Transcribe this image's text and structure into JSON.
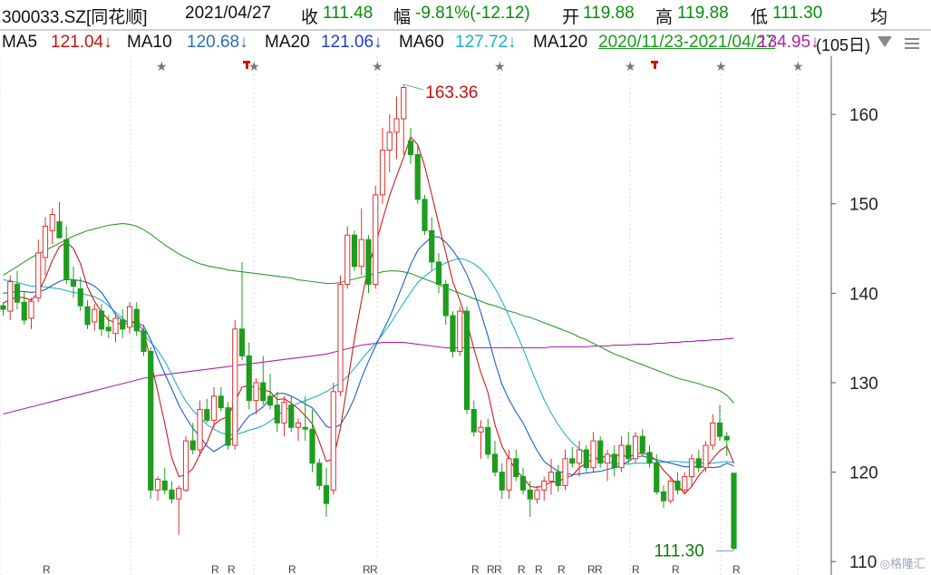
{
  "header": {
    "code": "300033.SZ[同花顺]",
    "date": "2021/04/27",
    "close_label": "收",
    "close_value": "111.48",
    "change_label": "幅",
    "change_value": "-9.81%(-12.12)",
    "open_label": "开",
    "open_value": "119.88",
    "high_label": "高",
    "high_value": "119.88",
    "low_label": "低",
    "low_value": "111.30",
    "avg_label": "均"
  },
  "ma_bar": {
    "ma5_label": "MA5",
    "ma5_value": "121.04↓",
    "ma10_label": "MA10",
    "ma10_value": "120.68↓",
    "ma20_label": "MA20",
    "ma20_value": "121.06↓",
    "ma60_label": "MA60",
    "ma60_value": "127.72↓",
    "ma120_label": "MA120",
    "overlap_a": "2020/11/23-2021/04/27",
    "overlap_b": "134.95↓",
    "days": "(105日)"
  },
  "chart_data": {
    "type": "candlestick",
    "ylim": [
      108.5,
      166.5
    ],
    "yticks": [
      110,
      120,
      130,
      140,
      150,
      160
    ],
    "ytick_labels": [
      "110",
      "120",
      "130",
      "140",
      "150",
      "160"
    ],
    "colors": {
      "up": "#e03030",
      "down": "#1e9c1e",
      "ma5": "#c81e1e",
      "ma10": "#1e5fcc",
      "ma20": "#20b4c8",
      "ma60": "#2aa02a",
      "ma120": "#b01eb0"
    },
    "annotations": [
      {
        "text": "163.36",
        "value": 163.36,
        "color": "#c81010"
      },
      {
        "text": "111.30",
        "value": 111.3,
        "color": "#0a7c0a"
      }
    ],
    "ohlc": [
      [
        138.6,
        139.0,
        137.5,
        138.2
      ],
      [
        138.0,
        142.0,
        137.0,
        141.3
      ],
      [
        141.0,
        142.5,
        138.2,
        139.0
      ],
      [
        139.0,
        140.2,
        136.5,
        137.0
      ],
      [
        137.2,
        139.5,
        136.0,
        139.1
      ],
      [
        139.5,
        146.0,
        139.0,
        144.5
      ],
      [
        144.0,
        148.5,
        142.0,
        147.5
      ],
      [
        147.0,
        149.5,
        145.5,
        148.8
      ],
      [
        148.0,
        150.2,
        146.5,
        146.2
      ],
      [
        146.0,
        147.5,
        141.0,
        141.5
      ],
      [
        141.5,
        143.0,
        139.5,
        140.8
      ],
      [
        140.5,
        141.8,
        138.0,
        138.6
      ],
      [
        138.5,
        139.2,
        136.0,
        136.5
      ],
      [
        136.8,
        138.8,
        135.8,
        138.2
      ],
      [
        138.0,
        138.8,
        135.2,
        136.0
      ],
      [
        136.2,
        137.5,
        135.0,
        135.8
      ],
      [
        135.5,
        137.8,
        134.5,
        137.2
      ],
      [
        137.0,
        138.2,
        135.0,
        136.0
      ],
      [
        136.2,
        139.0,
        135.5,
        138.5
      ],
      [
        138.2,
        139.0,
        135.2,
        135.8
      ],
      [
        135.8,
        136.5,
        133.0,
        133.5
      ],
      [
        133.5,
        134.0,
        117.0,
        118.0
      ],
      [
        118.0,
        119.5,
        116.8,
        119.2
      ],
      [
        119.0,
        120.5,
        117.5,
        118.0
      ],
      [
        118.0,
        119.0,
        116.5,
        117.0
      ],
      [
        117.0,
        118.5,
        113.0,
        118.2
      ],
      [
        118.0,
        124.0,
        117.8,
        123.5
      ],
      [
        123.5,
        125.5,
        122.0,
        122.5
      ],
      [
        122.5,
        128.0,
        121.8,
        127.0
      ],
      [
        127.0,
        128.2,
        125.5,
        125.8
      ],
      [
        125.8,
        129.5,
        125.0,
        128.5
      ],
      [
        128.5,
        129.5,
        126.8,
        127.2
      ],
      [
        127.2,
        127.8,
        122.5,
        123.0
      ],
      [
        123.0,
        137.0,
        122.5,
        136.0
      ],
      [
        136.0,
        143.5,
        132.5,
        133.0
      ],
      [
        133.0,
        134.5,
        127.0,
        128.0
      ],
      [
        128.0,
        130.5,
        126.5,
        130.0
      ],
      [
        130.0,
        133.0,
        127.5,
        128.0
      ],
      [
        128.5,
        131.0,
        127.0,
        127.5
      ],
      [
        127.5,
        129.0,
        124.5,
        125.5
      ],
      [
        125.5,
        128.5,
        124.0,
        127.8
      ],
      [
        127.5,
        128.5,
        124.5,
        125.0
      ],
      [
        125.0,
        126.0,
        123.5,
        125.5
      ],
      [
        125.0,
        128.5,
        123.5,
        124.8
      ],
      [
        124.8,
        127.0,
        120.0,
        121.0
      ],
      [
        121.0,
        121.5,
        118.0,
        118.5
      ],
      [
        118.5,
        120.5,
        115.0,
        116.5
      ],
      [
        118.0,
        130.0,
        117.5,
        129.0
      ],
      [
        129.0,
        142.0,
        128.5,
        141.0
      ],
      [
        141.0,
        147.5,
        140.5,
        146.5
      ],
      [
        146.5,
        147.0,
        142.5,
        143.0
      ],
      [
        143.0,
        149.5,
        142.0,
        146.0
      ],
      [
        146.0,
        146.5,
        140.0,
        141.0
      ],
      [
        141.0,
        152.0,
        140.5,
        151.0
      ],
      [
        151.0,
        158.5,
        150.0,
        156.0
      ],
      [
        156.0,
        160.0,
        153.5,
        158.0
      ],
      [
        158.0,
        162.0,
        155.0,
        159.5
      ],
      [
        159.5,
        163.36,
        155.5,
        163.0
      ],
      [
        157.0,
        158.5,
        154.5,
        155.5
      ],
      [
        155.5,
        156.5,
        150.0,
        150.5
      ],
      [
        150.5,
        151.0,
        146.5,
        147.0
      ],
      [
        147.0,
        148.5,
        142.5,
        143.5
      ],
      [
        143.5,
        144.5,
        140.0,
        141.0
      ],
      [
        141.0,
        141.5,
        136.5,
        137.5
      ],
      [
        137.5,
        138.0,
        132.8,
        133.5
      ],
      [
        133.5,
        138.5,
        133.0,
        138.0
      ],
      [
        138.0,
        138.5,
        126.5,
        127.0
      ],
      [
        127.0,
        128.0,
        124.0,
        124.5
      ],
      [
        124.5,
        125.8,
        121.5,
        125.0
      ],
      [
        125.0,
        126.0,
        121.5,
        122.0
      ],
      [
        122.0,
        123.5,
        119.5,
        120.0
      ],
      [
        120.0,
        121.0,
        117.0,
        118.0
      ],
      [
        118.0,
        122.5,
        117.0,
        121.5
      ],
      [
        121.5,
        122.5,
        119.0,
        119.5
      ],
      [
        119.5,
        120.5,
        117.5,
        118.0
      ],
      [
        118.0,
        119.0,
        115.0,
        117.0
      ],
      [
        117.0,
        118.5,
        116.5,
        118.0
      ],
      [
        118.0,
        119.5,
        116.8,
        119.0
      ],
      [
        119.0,
        121.5,
        117.5,
        120.0
      ],
      [
        120.0,
        120.8,
        117.8,
        118.5
      ],
      [
        118.5,
        122.5,
        118.0,
        121.5
      ],
      [
        121.5,
        122.8,
        120.5,
        121.0
      ],
      [
        121.0,
        123.5,
        119.5,
        122.5
      ],
      [
        122.5,
        123.0,
        120.0,
        120.5
      ],
      [
        120.5,
        124.5,
        120.0,
        123.5
      ],
      [
        123.5,
        124.0,
        120.5,
        121.0
      ],
      [
        121.0,
        122.5,
        119.0,
        122.0
      ],
      [
        122.0,
        123.0,
        119.5,
        120.5
      ],
      [
        120.5,
        124.0,
        120.0,
        123.0
      ],
      [
        123.0,
        124.5,
        121.0,
        121.5
      ],
      [
        121.5,
        124.5,
        121.0,
        124.0
      ],
      [
        124.0,
        124.8,
        121.8,
        122.2
      ],
      [
        122.2,
        123.0,
        120.5,
        121.0
      ],
      [
        121.0,
        122.0,
        117.5,
        117.8
      ],
      [
        117.8,
        118.5,
        116.0,
        116.8
      ],
      [
        116.8,
        119.5,
        116.5,
        119.0
      ],
      [
        119.0,
        120.0,
        117.5,
        118.0
      ],
      [
        118.0,
        120.0,
        117.5,
        119.5
      ],
      [
        119.5,
        122.0,
        118.5,
        121.5
      ],
      [
        121.5,
        122.5,
        120.0,
        120.5
      ],
      [
        120.5,
        123.5,
        120.0,
        123.0
      ],
      [
        123.0,
        126.5,
        122.5,
        125.5
      ],
      [
        125.5,
        127.5,
        123.5,
        124.0
      ],
      [
        124.0,
        124.5,
        121.8,
        123.6
      ],
      [
        119.88,
        119.88,
        111.3,
        111.48
      ]
    ],
    "ma5": [
      138.9,
      139.3,
      139.6,
      139.5,
      139.2,
      140.1,
      141.7,
      143.7,
      145.2,
      145.7,
      145.0,
      143.3,
      140.7,
      139.1,
      137.9,
      137.0,
      136.7,
      136.5,
      136.7,
      136.7,
      135.8,
      132.4,
      129.0,
      125.4,
      121.6,
      119.5,
      119.7,
      120.4,
      122.0,
      123.3,
      125.3,
      125.9,
      126.2,
      127.9,
      129.5,
      129.7,
      129.4,
      129.2,
      129.0,
      128.1,
      128.2,
      127.7,
      127.1,
      126.3,
      125.4,
      123.4,
      121.2,
      121.5,
      124.9,
      129.9,
      134.9,
      139.2,
      143.0,
      145.5,
      148.2,
      150.9,
      153.1,
      155.2,
      157.5,
      156.6,
      154.2,
      151.0,
      147.7,
      144.5,
      141.3,
      139.2,
      136.8,
      133.8,
      131.1,
      128.9,
      125.3,
      122.9,
      121.5,
      120.2,
      119.4,
      118.4,
      118.3,
      118.5,
      118.9,
      118.9,
      119.4,
      119.6,
      120.5,
      121.0,
      121.5,
      121.6,
      121.8,
      121.8,
      122.0,
      121.6,
      122.1,
      122.1,
      121.9,
      121.3,
      120.2,
      119.4,
      118.5,
      117.6,
      118.4,
      119.6,
      120.5,
      121.5,
      122.4,
      122.9,
      121.0
    ],
    "ma10": [
      140.0,
      140.1,
      140.2,
      140.2,
      140.1,
      140.2,
      140.4,
      140.9,
      141.3,
      141.6,
      141.5,
      141.4,
      141.2,
      140.8,
      140.1,
      138.9,
      137.6,
      136.9,
      136.8,
      136.8,
      136.3,
      134.8,
      132.8,
      131.0,
      129.3,
      127.5,
      126.1,
      124.9,
      124.0,
      122.9,
      122.3,
      122.8,
      123.3,
      124.1,
      125.3,
      126.3,
      126.7,
      127.3,
      128.2,
      128.8,
      128.8,
      128.5,
      128.1,
      127.6,
      127.2,
      126.2,
      125.1,
      124.9,
      125.3,
      126.6,
      128.3,
      130.5,
      132.4,
      134.1,
      135.7,
      137.3,
      139.2,
      141.2,
      143.2,
      144.8,
      145.6,
      146.3,
      146.3,
      145.7,
      144.8,
      143.6,
      142.1,
      140.2,
      137.8,
      135.2,
      132.3,
      129.8,
      128.1,
      126.7,
      125.5,
      123.9,
      122.4,
      121.2,
      120.6,
      120.1,
      119.9,
      119.7,
      119.8,
      119.9,
      120.0,
      120.1,
      120.3,
      120.5,
      120.8,
      121.2,
      121.7,
      121.8,
      121.6,
      121.4,
      121.2,
      121.0,
      120.8,
      120.6,
      120.6,
      120.6,
      120.6,
      120.5,
      120.6,
      121.0,
      120.7
    ],
    "ma20": [
      141.5,
      141.4,
      141.2,
      141.0,
      140.8,
      140.8,
      140.7,
      140.6,
      140.5,
      140.3,
      140.1,
      140.0,
      139.8,
      139.6,
      139.2,
      138.6,
      137.9,
      137.2,
      136.6,
      136.1,
      135.4,
      134.5,
      133.6,
      132.4,
      130.9,
      129.3,
      127.9,
      126.9,
      126.1,
      125.3,
      124.8,
      124.4,
      124.2,
      124.2,
      124.4,
      124.7,
      124.9,
      125.2,
      125.7,
      126.3,
      126.9,
      127.3,
      127.7,
      128.0,
      128.3,
      128.6,
      129.0,
      129.5,
      130.0,
      130.7,
      131.6,
      132.6,
      133.5,
      134.4,
      135.4,
      136.5,
      137.7,
      138.9,
      140.1,
      141.2,
      141.9,
      142.5,
      143.0,
      143.4,
      143.7,
      143.9,
      143.7,
      143.3,
      142.7,
      141.8,
      140.6,
      139.1,
      137.4,
      135.6,
      133.8,
      131.8,
      129.9,
      128.1,
      126.6,
      125.3,
      124.2,
      123.3,
      122.6,
      122.1,
      121.7,
      121.3,
      121.1,
      121.0,
      120.9,
      120.9,
      121.0,
      121.0,
      121.0,
      121.1,
      121.1,
      121.2,
      121.2,
      121.1,
      121.1,
      121.0,
      121.0,
      121.0,
      121.1,
      121.2,
      121.06
    ],
    "ma60": [
      142.0,
      142.5,
      143.0,
      143.5,
      144.0,
      144.4,
      144.8,
      145.2,
      145.6,
      146.0,
      146.4,
      146.7,
      147.0,
      147.2,
      147.4,
      147.6,
      147.7,
      147.8,
      147.7,
      147.5,
      147.1,
      146.6,
      146.0,
      145.4,
      144.9,
      144.4,
      144.0,
      143.6,
      143.3,
      143.1,
      142.9,
      142.8,
      142.6,
      142.5,
      142.4,
      142.3,
      142.2,
      142.1,
      142.0,
      141.9,
      141.8,
      141.7,
      141.5,
      141.4,
      141.3,
      141.2,
      141.1,
      141.1,
      141.2,
      141.4,
      141.6,
      141.8,
      142.0,
      142.2,
      142.4,
      142.5,
      142.5,
      142.4,
      142.2,
      141.9,
      141.6,
      141.3,
      141.0,
      140.6,
      140.3,
      140.0,
      139.7,
      139.4,
      139.1,
      138.8,
      138.6,
      138.3,
      138.0,
      137.8,
      137.5,
      137.3,
      137.0,
      136.7,
      136.4,
      136.1,
      135.8,
      135.5,
      135.1,
      134.8,
      134.4,
      134.0,
      133.6,
      133.2,
      132.9,
      132.6,
      132.3,
      132.0,
      131.7,
      131.4,
      131.1,
      130.8,
      130.5,
      130.3,
      130.1,
      129.9,
      129.6,
      129.4,
      129.1,
      128.6,
      127.72
    ],
    "ma120": [
      126.5,
      126.7,
      126.9,
      127.1,
      127.3,
      127.5,
      127.7,
      127.9,
      128.1,
      128.3,
      128.5,
      128.7,
      128.9,
      129.1,
      129.3,
      129.5,
      129.7,
      129.9,
      130.1,
      130.3,
      130.5,
      130.6,
      130.8,
      130.9,
      131.0,
      131.1,
      131.2,
      131.3,
      131.4,
      131.5,
      131.6,
      131.7,
      131.8,
      131.9,
      132.0,
      132.1,
      132.2,
      132.3,
      132.4,
      132.5,
      132.6,
      132.7,
      132.8,
      132.9,
      133.0,
      133.1,
      133.2,
      133.4,
      133.6,
      133.8,
      134.0,
      134.2,
      134.3,
      134.4,
      134.5,
      134.5,
      134.5,
      134.5,
      134.4,
      134.3,
      134.2,
      134.1,
      134.0,
      133.9,
      133.9,
      133.9,
      133.9,
      133.9,
      133.9,
      133.9,
      133.9,
      133.9,
      133.9,
      133.9,
      133.9,
      133.9,
      133.9,
      133.9,
      134.0,
      134.0,
      134.0,
      134.0,
      134.0,
      134.0,
      134.1,
      134.1,
      134.1,
      134.2,
      134.2,
      134.2,
      134.3,
      134.3,
      134.3,
      134.4,
      134.4,
      134.5,
      134.5,
      134.6,
      134.6,
      134.7,
      134.7,
      134.8,
      134.8,
      134.9,
      134.95
    ]
  }
}
